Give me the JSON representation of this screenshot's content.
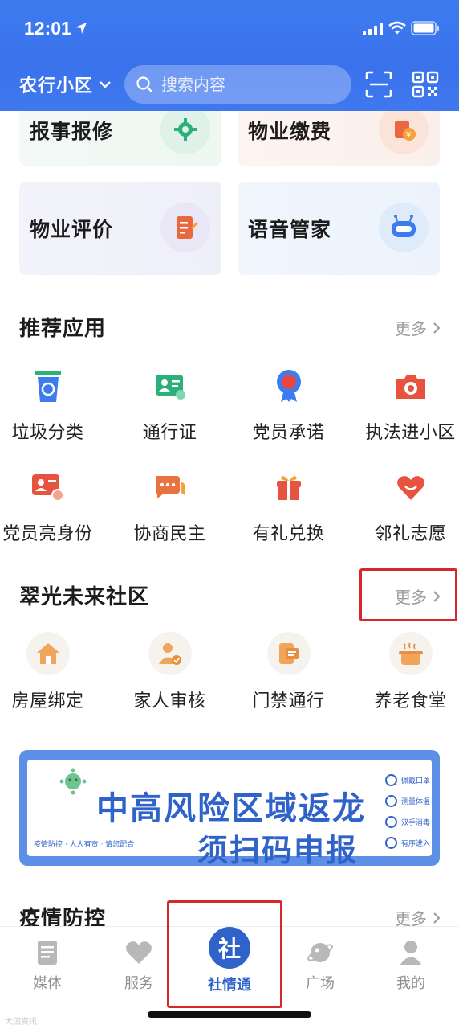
{
  "status_bar": {
    "time": "12:01"
  },
  "header": {
    "community": "农行小区",
    "search_placeholder": "搜索内容",
    "scan_icon": "scan-icon",
    "qr_icon": "qrcode-icon"
  },
  "services": [
    {
      "label": "报事报修",
      "icon": "wrench-gear-icon"
    },
    {
      "label": "物业缴费",
      "icon": "payment-icon"
    },
    {
      "label": "物业评价",
      "icon": "notebook-edit-icon"
    },
    {
      "label": "语音管家",
      "icon": "robot-icon"
    }
  ],
  "recommended": {
    "title": "推荐应用",
    "more": "更多",
    "apps": [
      {
        "label": "垃圾分类",
        "icon": "recycle-bin-icon"
      },
      {
        "label": "通行证",
        "icon": "id-card-icon"
      },
      {
        "label": "党员承诺",
        "icon": "party-badge-icon"
      },
      {
        "label": "执法进小区",
        "icon": "camera-icon"
      },
      {
        "label": "党员亮身份",
        "icon": "member-id-icon"
      },
      {
        "label": "协商民主",
        "icon": "chat-bubbles-icon"
      },
      {
        "label": "有礼兑换",
        "icon": "gift-icon"
      },
      {
        "label": "邻礼志愿",
        "icon": "smile-heart-icon"
      }
    ]
  },
  "community_section": {
    "title": "翠光未来社区",
    "more": "更多",
    "apps": [
      {
        "label": "房屋绑定",
        "icon": "house-icon"
      },
      {
        "label": "家人审核",
        "icon": "person-check-icon"
      },
      {
        "label": "门禁通行",
        "icon": "access-card-icon"
      },
      {
        "label": "养老食堂",
        "icon": "food-pot-icon"
      }
    ]
  },
  "banner": {
    "line1": "中高风险区域返龙",
    "line2": "须扫码申报",
    "slogan": "疫情防控 · 人人有责 · 请您配合",
    "tips": [
      "佩戴口罩",
      "测量体温",
      "双手消毒",
      "有序进入"
    ]
  },
  "epidemic": {
    "title": "疫情防控",
    "more": "更多"
  },
  "tabs": [
    {
      "label": "媒体",
      "icon": "news-icon",
      "active": false
    },
    {
      "label": "服务",
      "icon": "heart-icon",
      "active": false
    },
    {
      "label": "社情通",
      "icon": "she-logo-icon",
      "active": true
    },
    {
      "label": "广场",
      "icon": "planet-icon",
      "active": false
    },
    {
      "label": "我的",
      "icon": "user-icon",
      "active": false
    }
  ],
  "watermark": "大国资讯",
  "colors": {
    "brand_blue": "#3d7bf0",
    "active_tab": "#2f63c9",
    "highlight_red": "#d7262c"
  }
}
